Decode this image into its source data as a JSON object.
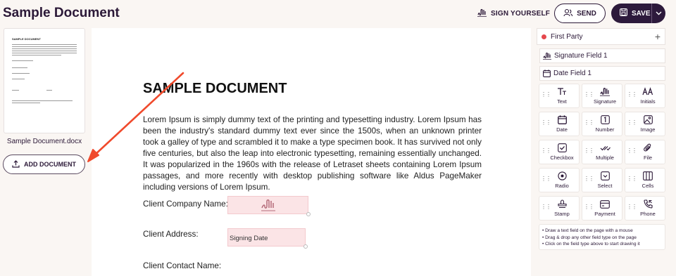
{
  "header": {
    "title": "Sample Document",
    "sign_yourself": "SIGN YOURSELF",
    "send": "SEND",
    "save": "SAVE"
  },
  "left_panel": {
    "thumbnail_title": "SAMPLE DOCUMENT",
    "file_name": "Sample Document.docx",
    "add_document": "ADD DOCUMENT"
  },
  "document": {
    "heading": "SAMPLE DOCUMENT",
    "body": "Lorem Ipsum is simply dummy text of the printing and typesetting industry. Lorem Ipsum has been the industry's standard dummy text ever since the 1500s, when an unknown printer took a galley of type and scrambled it to make a type specimen book. It has survived not only five centuries, but also the leap into electronic typesetting, remaining essentially unchanged. It was popularized in the 1960s with the release of Letraset sheets containing Lorem Ipsum passages, and more recently with desktop publishing software like Aldus PageMaker including versions of Lorem Ipsum.",
    "labels": {
      "company": "Client Company Name:",
      "address": "Client Address:",
      "contact": "Client Contact Name:"
    },
    "date_field": "Signing Date"
  },
  "sidebar": {
    "party": "First Party",
    "party_color": "#e5484d",
    "assigned_fields": [
      {
        "label": "Signature Field 1",
        "icon": "signature-icon"
      },
      {
        "label": "Date Field 1",
        "icon": "calendar-icon"
      }
    ],
    "field_types": [
      {
        "label": "Text",
        "icon": "text-icon"
      },
      {
        "label": "Signature",
        "icon": "signature-icon"
      },
      {
        "label": "Initials",
        "icon": "initials-icon"
      },
      {
        "label": "Date",
        "icon": "calendar-icon"
      },
      {
        "label": "Number",
        "icon": "number-icon"
      },
      {
        "label": "Image",
        "icon": "image-icon"
      },
      {
        "label": "Checkbox",
        "icon": "checkbox-icon"
      },
      {
        "label": "Multiple",
        "icon": "multiple-icon"
      },
      {
        "label": "File",
        "icon": "paperclip-icon"
      },
      {
        "label": "Radio",
        "icon": "radio-icon"
      },
      {
        "label": "Select",
        "icon": "select-icon"
      },
      {
        "label": "Cells",
        "icon": "cells-icon"
      },
      {
        "label": "Stamp",
        "icon": "stamp-icon"
      },
      {
        "label": "Payment",
        "icon": "payment-icon"
      },
      {
        "label": "Phone",
        "icon": "phone-icon"
      }
    ],
    "hints": [
      "Draw a text field on the page with a mouse",
      "Drag & drop any other field type on the page",
      "Click on the field type above to start drawing it"
    ]
  },
  "colors": {
    "accent": "#2d1a3c",
    "field_fill": "#fbe4e6",
    "arrow": "#f04a2c"
  }
}
